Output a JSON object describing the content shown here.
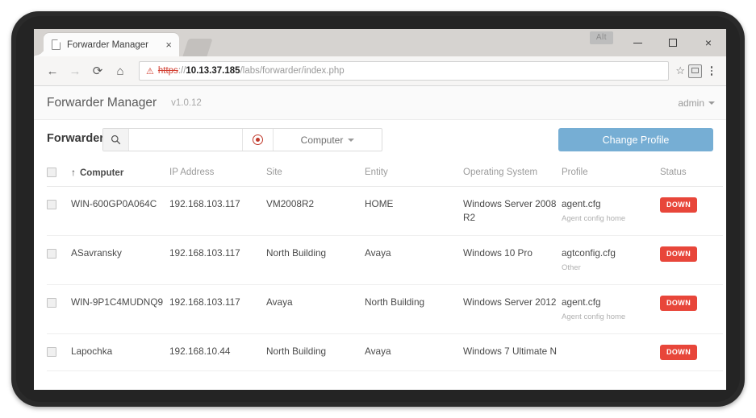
{
  "browser": {
    "tab": {
      "title": "Forwarder Manager",
      "favicon": "page-icon",
      "close": "×"
    },
    "window_controls": {
      "alt_badge": "Alt",
      "minimize": "minimize-icon",
      "maximize": "maximize-icon",
      "close": "×"
    },
    "nav": {
      "back": "←",
      "forward": "→",
      "reload": "⟳",
      "home": "⌂"
    },
    "omnibox": {
      "not_secure_icon": "⚠",
      "scheme": "https",
      "separator": "://",
      "host": "10.13.37.185",
      "path": "/labs/forwarder/index.php"
    },
    "omni_actions": {
      "star": "☆",
      "extension": "save-icon",
      "menu": "menu-dots-icon"
    }
  },
  "app": {
    "title": "Forwarder Manager",
    "version": "v1.0.12",
    "user": "admin"
  },
  "toolbar": {
    "section_label": "Forwarders",
    "search_icon": "search-icon",
    "search_value": "",
    "search_placeholder": "",
    "clear_icon": "clear-target-icon",
    "filter_label": "Computer",
    "change_profile_label": "Change Profile"
  },
  "table": {
    "columns": [
      {
        "key": "check",
        "label": ""
      },
      {
        "key": "name",
        "label": "Computer",
        "sorted": true,
        "sort_arrow": "↑"
      },
      {
        "key": "ip",
        "label": "IP Address"
      },
      {
        "key": "site",
        "label": "Site"
      },
      {
        "key": "entity",
        "label": "Entity"
      },
      {
        "key": "os",
        "label": "Operating System"
      },
      {
        "key": "profile",
        "label": "Profile"
      },
      {
        "key": "status",
        "label": "Status"
      }
    ],
    "rows": [
      {
        "name": "WIN-600GP0A064C",
        "ip": "192.168.103.117",
        "site": "VM2008R2",
        "entity": "HOME",
        "os": "Windows Server 2008 R2",
        "profile_name": "agent.cfg",
        "profile_sub": "Agent config home",
        "status": "DOWN"
      },
      {
        "name": "ASavransky",
        "ip": "192.168.103.117",
        "site": "North Building",
        "entity": "Avaya",
        "os": "Windows 10 Pro",
        "profile_name": "agtconfig.cfg",
        "profile_sub": "Other",
        "status": "DOWN"
      },
      {
        "name": "WIN-9P1C4MUDNQ9",
        "ip": "192.168.103.117",
        "site": "Avaya",
        "entity": "North Building",
        "os": "Windows Server 2012",
        "profile_name": "agent.cfg",
        "profile_sub": "Agent config home",
        "status": "DOWN"
      },
      {
        "name": "Lapochka",
        "ip": "192.168.10.44",
        "site": "North Building",
        "entity": "Avaya",
        "os": "Windows 7 Ultimate N",
        "profile_name": "",
        "profile_sub": "",
        "status": "DOWN"
      }
    ]
  },
  "colors": {
    "accent": "#76aed4",
    "status_down": "#e8463a",
    "not_secure": "#d23f31"
  }
}
